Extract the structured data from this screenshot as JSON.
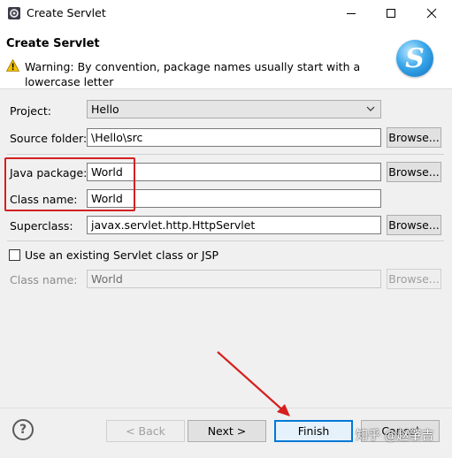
{
  "window": {
    "title": "Create Servlet"
  },
  "banner": {
    "title": "Create Servlet",
    "warning": "Warning: By convention, package names usually start with a lowercase letter"
  },
  "form": {
    "project_label": "Project:",
    "project_value": "Hello",
    "source_folder_label": "Source folder:",
    "source_folder_value": "\\Hello\\src",
    "java_package_label": "Java package:",
    "java_package_value": "World",
    "class_name_label": "Class name:",
    "class_name_value": "World",
    "superclass_label": "Superclass:",
    "superclass_value": "javax.servlet.http.HttpServlet",
    "use_existing_label": "Use an existing Servlet class or JSP",
    "existing_class_label": "Class name:",
    "existing_class_value": "World",
    "browse_label": "Browse..."
  },
  "buttons": {
    "help": "?",
    "back": "< Back",
    "next": "Next >",
    "finish": "Finish",
    "cancel": "Cancel"
  },
  "watermark": "知乎 @赵肇吉",
  "colors": {
    "annotation_red": "#d42020",
    "focus_blue": "#0078d7"
  }
}
